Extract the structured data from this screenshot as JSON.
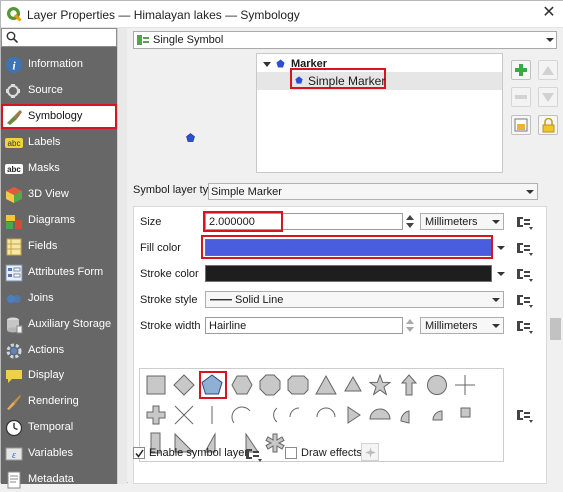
{
  "window": {
    "title": "Layer Properties — Himalayan lakes — Symbology",
    "close_glyph": "✕"
  },
  "sidebar": {
    "search_placeholder": "",
    "items": [
      {
        "label": "Information",
        "icon": "info-icon"
      },
      {
        "label": "Source",
        "icon": "source-icon"
      },
      {
        "label": "Symbology",
        "icon": "symbology-brush-icon"
      },
      {
        "label": "Labels",
        "icon": "labels-abc-icon"
      },
      {
        "label": "Masks",
        "icon": "masks-abc-icon"
      },
      {
        "label": "3D View",
        "icon": "3d-cube-icon"
      },
      {
        "label": "Diagrams",
        "icon": "diagrams-icon"
      },
      {
        "label": "Fields",
        "icon": "fields-icon"
      },
      {
        "label": "Attributes Form",
        "icon": "attributes-form-icon"
      },
      {
        "label": "Joins",
        "icon": "joins-icon"
      },
      {
        "label": "Auxiliary Storage",
        "icon": "auxiliary-storage-icon"
      },
      {
        "label": "Actions",
        "icon": "actions-gear-icon"
      },
      {
        "label": "Display",
        "icon": "display-speech-icon"
      },
      {
        "label": "Rendering",
        "icon": "rendering-brush-icon"
      },
      {
        "label": "Temporal",
        "icon": "temporal-clock-icon"
      },
      {
        "label": "Variables",
        "icon": "variables-icon"
      },
      {
        "label": "Metadata",
        "icon": "metadata-icon"
      }
    ],
    "active": "Symbology"
  },
  "renderer": {
    "label": "Single Symbol"
  },
  "tree": {
    "root_label": "Marker",
    "child_label": "Simple Marker"
  },
  "symbol_layer": {
    "type_label": "Symbol layer type",
    "type_value": "Simple Marker"
  },
  "properties": {
    "size": {
      "label": "Size",
      "value": "2.000000",
      "unit": "Millimeters"
    },
    "fill_color": {
      "label": "Fill color",
      "color": "#4a5ddd"
    },
    "stroke_color": {
      "label": "Stroke color",
      "color": "#1e1e1e"
    },
    "stroke_style": {
      "label": "Stroke style",
      "value": "Solid Line"
    },
    "stroke_width": {
      "label": "Stroke width",
      "value": "Hairline",
      "unit": "Millimeters"
    }
  },
  "footer": {
    "enable_symbol_layer": "Enable symbol layer",
    "draw_effects": "Draw effects"
  },
  "colors": {
    "accent_highlight": "#d3161f",
    "sidebar_bg": "#676767",
    "marker_blue": "#2c4fd6",
    "shape_fill": "#c8c8c8",
    "selected_shape_fill": "#8fb0d4"
  }
}
